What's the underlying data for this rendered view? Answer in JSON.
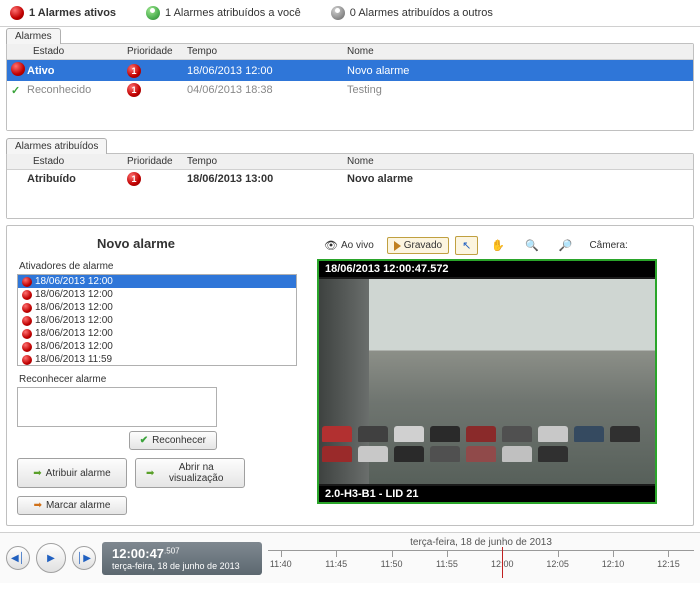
{
  "header": {
    "active_alarms": "1 Alarmes ativos",
    "assigned_to_you": "1 Alarmes atribuídos a você",
    "assigned_to_others": "0 Alarmes atribuídos a outros"
  },
  "alarms_panel": {
    "tab": "Alarmes",
    "columns": {
      "estado": "Estado",
      "prioridade": "Prioridade",
      "tempo": "Tempo",
      "nome": "Nome"
    },
    "rows": [
      {
        "estado": "Ativo",
        "prioridade": "1",
        "tempo": "18/06/2013 12:00",
        "nome": "Novo alarme",
        "selected": true
      },
      {
        "estado": "Reconhecido",
        "prioridade": "1",
        "tempo": "04/06/2013 18:38",
        "nome": "Testing",
        "selected": false
      }
    ]
  },
  "assigned_panel": {
    "tab": "Alarmes atribuídos",
    "columns": {
      "estado": "Estado",
      "prioridade": "Prioridade",
      "tempo": "Tempo",
      "nome": "Nome"
    },
    "rows": [
      {
        "estado": "Atribuído",
        "prioridade": "1",
        "tempo": "18/06/2013 13:00",
        "nome": "Novo alarme"
      }
    ]
  },
  "detail": {
    "title": "Novo alarme",
    "triggers_label": "Ativadores de alarme",
    "triggers": [
      "18/06/2013 12:00",
      "18/06/2013 12:00",
      "18/06/2013 12:00",
      "18/06/2013 12:00",
      "18/06/2013 12:00",
      "18/06/2013 12:00",
      "18/06/2013 11:59"
    ],
    "ack_label": "Reconhecer alarme",
    "btn_ack": "Reconhecer",
    "btn_assign": "Atribuir alarme",
    "btn_open_view": "Abrir na visualização",
    "btn_mark": "Marcar alarme"
  },
  "video": {
    "live": "Ao vivo",
    "recorded": "Gravado",
    "camera_label": "Câmera:",
    "timestamp": "18/06/2013 12:00:47.572",
    "camera_name": "2.0-H3-B1 - LID 21"
  },
  "playback": {
    "time": "12:00:47",
    "time_ms": ".507",
    "date": "terça-feira, 18 de junho de 2013",
    "timeline_date": "terça-feira, 18 de junho de 2013",
    "ticks": [
      "11:40",
      "11:45",
      "11:50",
      "11:55",
      "12:00",
      "12:05",
      "12:10",
      "12:15"
    ]
  }
}
